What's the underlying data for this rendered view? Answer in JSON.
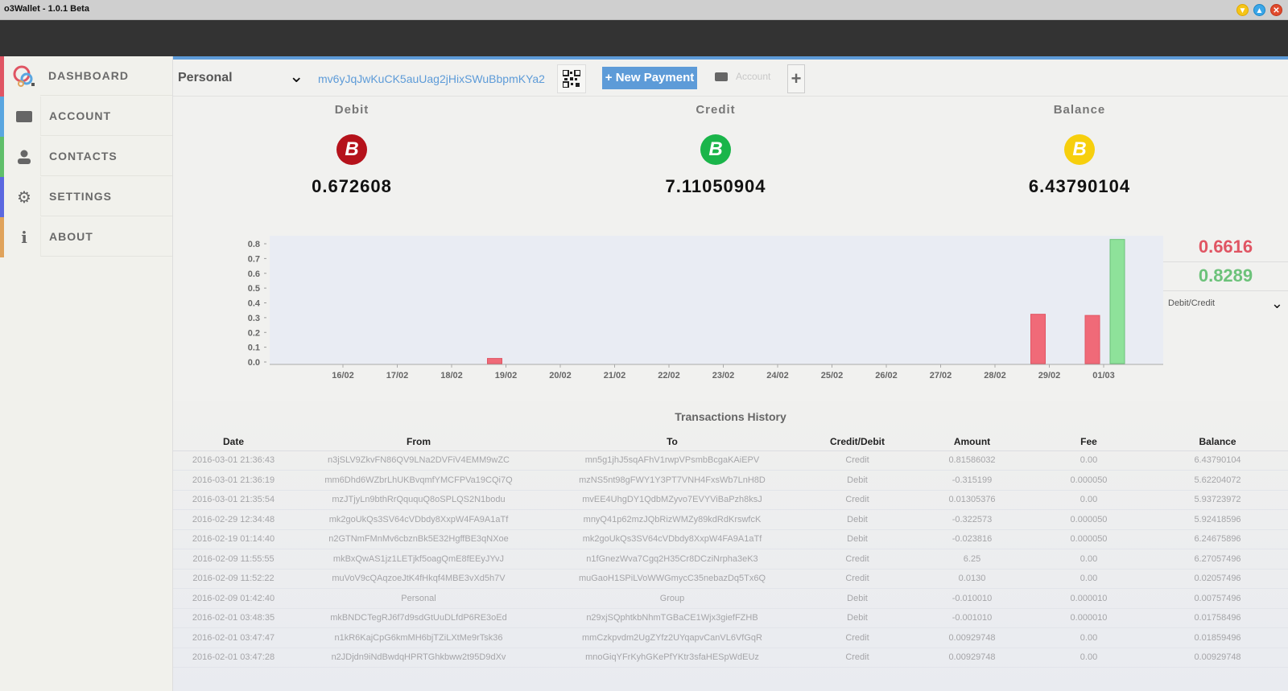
{
  "window": {
    "title": "o3Wallet - 1.0.1 Beta",
    "controls": [
      "minimize",
      "maximize",
      "close"
    ]
  },
  "sidebar": {
    "items": [
      {
        "label": "DASHBOARD",
        "icon": "logo-icon",
        "stripe": "#e05563"
      },
      {
        "label": "ACCOUNT",
        "icon": "wallet-icon",
        "stripe": "#5aa6e0"
      },
      {
        "label": "CONTACTS",
        "icon": "user-icon",
        "stripe": "#5fbf6a"
      },
      {
        "label": "SETTINGS",
        "icon": "gear-icon",
        "stripe": "#5b68e0"
      },
      {
        "label": "ABOUT",
        "icon": "info-icon",
        "stripe": "#e0a35b"
      }
    ]
  },
  "toolbar": {
    "account_selected": "Personal",
    "address": "mv6yJqJwKuCK5auUag2jHixSWuBbpmKYa2",
    "new_payment_label": "+ New Payment",
    "account_label": "Account",
    "add_label": "+"
  },
  "stats": {
    "debit": {
      "label": "Debit",
      "value": "0.672608",
      "color": "#b5121b"
    },
    "credit": {
      "label": "Credit",
      "value": "7.11050904",
      "color": "#1ab54a"
    },
    "balance": {
      "label": "Balance",
      "value": "6.43790104",
      "color": "#f7cf0d"
    }
  },
  "chart_side": {
    "debit_value": "0.6616",
    "credit_value": "0.8289",
    "mode_label": "Debit/Credit",
    "debit_color": "#e05563",
    "credit_color": "#6cc27a"
  },
  "chart_data": {
    "type": "bar",
    "title": "",
    "xlabel": "",
    "ylabel": "",
    "ylim": [
      0,
      0.85
    ],
    "yticks": [
      "0.0",
      "0.1",
      "0.2",
      "0.3",
      "0.4",
      "0.5",
      "0.6",
      "0.7",
      "0.8"
    ],
    "categories": [
      "16/02",
      "17/02",
      "18/02",
      "19/02",
      "20/02",
      "21/02",
      "22/02",
      "23/02",
      "24/02",
      "25/02",
      "26/02",
      "27/02",
      "28/02",
      "29/02",
      "01/03"
    ],
    "series": [
      {
        "name": "Debit",
        "color": "#f06a78",
        "values": [
          0,
          0,
          0,
          0.024,
          0,
          0,
          0,
          0,
          0,
          0,
          0,
          0,
          0,
          0.323,
          0.315
        ]
      },
      {
        "name": "Credit",
        "color": "#8ee29a",
        "values": [
          0,
          0,
          0,
          0,
          0,
          0,
          0,
          0,
          0,
          0,
          0,
          0,
          0,
          0,
          0.829
        ]
      }
    ],
    "grid": false,
    "legend": "none"
  },
  "history": {
    "title": "Transactions History",
    "columns": [
      "Date",
      "From",
      "To",
      "Credit/Debit",
      "Amount",
      "Fee",
      "Balance"
    ],
    "rows": [
      [
        "2016-03-01 21:36:43",
        "n3jSLV9ZkvFN86QV9LNa2DVFiV4EMM9wZC",
        "mn5g1jhJ5sqAFhV1rwpVPsmbBcgaKAiEPV",
        "Credit",
        "0.81586032",
        "0.00",
        "6.43790104"
      ],
      [
        "2016-03-01 21:36:19",
        "mm6Dhd6WZbrLhUKBvqmfYMCFPVa19CQi7Q",
        "mzNS5nt98gFWY1Y3PT7VNH4FxsWb7LnH8D",
        "Debit",
        "-0.315199",
        "0.000050",
        "5.62204072"
      ],
      [
        "2016-03-01 21:35:54",
        "mzJTjyLn9bthRrQququQ8oSPLQS2N1bodu",
        "mvEE4UhgDY1QdbMZyvo7EVYViBaPzh8ksJ",
        "Credit",
        "0.01305376",
        "0.00",
        "5.93723972"
      ],
      [
        "2016-02-29 12:34:48",
        "mk2goUkQs3SV64cVDbdy8XxpW4FA9A1aTf",
        "mnyQ41p62mzJQbRizWMZy89kdRdKrswfcK",
        "Debit",
        "-0.322573",
        "0.000050",
        "5.92418596"
      ],
      [
        "2016-02-19 01:14:40",
        "n2GTNmFMnMv6cbznBk5E32HgffBE3qNXoe",
        "mk2goUkQs3SV64cVDbdy8XxpW4FA9A1aTf",
        "Debit",
        "-0.023816",
        "0.000050",
        "6.24675896"
      ],
      [
        "2016-02-09 11:55:55",
        "mkBxQwAS1jz1LETjkf5oagQmE8fEEyJYvJ",
        "n1fGnezWva7Cgq2H35Cr8DCziNrpha3eK3",
        "Credit",
        "6.25",
        "0.00",
        "6.27057496"
      ],
      [
        "2016-02-09 11:52:22",
        "muVoV9cQAqzoeJtK4fHkqf4MBE3vXd5h7V",
        "muGaoH1SPiLVoWWGmycC35nebazDq5Tx6Q",
        "Credit",
        "0.0130",
        "0.00",
        "0.02057496"
      ],
      [
        "2016-02-09 01:42:40",
        "Personal",
        "Group",
        "Debit",
        "-0.010010",
        "0.000010",
        "0.00757496"
      ],
      [
        "2016-02-01 03:48:35",
        "mkBNDCTegRJ6f7d9sdGtUuDLfdP6RE3oEd",
        "n29xjSQphtkbNhmTGBaCE1Wjx3giefFZHB",
        "Debit",
        "-0.001010",
        "0.000010",
        "0.01758496"
      ],
      [
        "2016-02-01 03:47:47",
        "n1kR6KajCpG6kmMH6bjTZiLXtMe9rTsk36",
        "mmCzkpvdm2UgZYfz2UYqapvCanVL6VfGqR",
        "Credit",
        "0.00929748",
        "0.00",
        "0.01859496"
      ],
      [
        "2016-02-01 03:47:28",
        "n2JDjdn9iNdBwdqHPRTGhkbww2t95D9dXv",
        "mnoGiqYFrKyhGKePfYKtr3sfaHESpWdEUz",
        "Credit",
        "0.00929748",
        "0.00",
        "0.00929748"
      ]
    ]
  }
}
